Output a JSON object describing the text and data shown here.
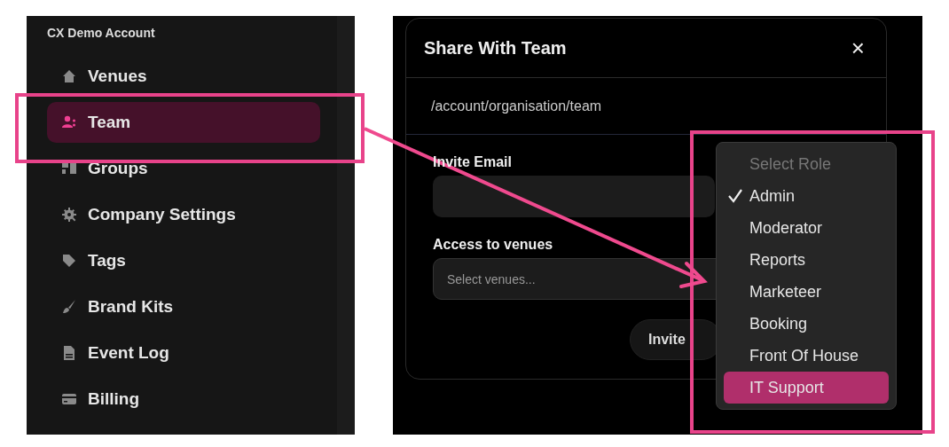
{
  "sidebar": {
    "title": "CX Demo Account",
    "items": [
      {
        "label": "Venues",
        "selected": false
      },
      {
        "label": "Team",
        "selected": true
      },
      {
        "label": "Groups",
        "selected": false
      },
      {
        "label": "Company Settings",
        "selected": false
      },
      {
        "label": "Tags",
        "selected": false
      },
      {
        "label": "Brand Kits",
        "selected": false
      },
      {
        "label": "Event Log",
        "selected": false
      },
      {
        "label": "Billing",
        "selected": false
      }
    ]
  },
  "modal": {
    "title": "Share With Team",
    "close": "×",
    "path": "/account/organisation/team",
    "fields": [
      {
        "kind": "text",
        "label": "Invite Email"
      },
      {
        "kind": "select",
        "label": "Access to venues",
        "placeholder": "Select venues..."
      }
    ],
    "button": "Invite"
  },
  "role_menu": {
    "header": "Select Role",
    "items": [
      {
        "label": "Admin",
        "checked": true,
        "highlighted": false
      },
      {
        "label": "Moderator",
        "checked": false,
        "highlighted": false
      },
      {
        "label": "Reports",
        "checked": false,
        "highlighted": false
      },
      {
        "label": "Marketeer",
        "checked": false,
        "highlighted": false
      },
      {
        "label": "Booking",
        "checked": false,
        "highlighted": false
      },
      {
        "label": "Front Of House",
        "checked": false,
        "highlighted": false
      },
      {
        "label": "IT Support",
        "checked": false,
        "highlighted": true
      }
    ]
  }
}
